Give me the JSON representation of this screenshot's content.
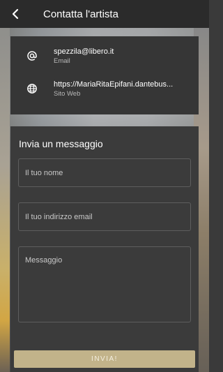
{
  "header": {
    "title": "Contatta l'artista"
  },
  "contacts": [
    {
      "value": "spezzila@libero.it",
      "label": "Email",
      "icon": "at-icon"
    },
    {
      "value": "https://MariaRitaEpifani.dantebus...",
      "label": "Sito Web",
      "icon": "globe-icon"
    }
  ],
  "form": {
    "title": "Invia un messaggio",
    "name_placeholder": "Il tuo nome",
    "email_placeholder": "Il tuo indirizzo email",
    "message_placeholder": "Messaggio",
    "send_label": "INVIA!"
  },
  "colors": {
    "accent": "#c2b38a",
    "panel": "#3b3b3b",
    "topbar": "#2b2b2b"
  }
}
